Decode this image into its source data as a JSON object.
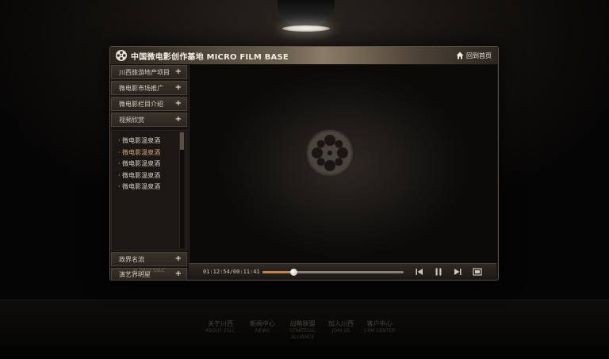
{
  "header": {
    "title": "中国微电影创作基地 MICRO FILM BASE",
    "home_label": "回到首页"
  },
  "sidebar": {
    "items": [
      {
        "label": "川西旅游地产项目",
        "toggle": "+"
      },
      {
        "label": "微电影市场推广",
        "toggle": "+"
      },
      {
        "label": "微电影栏目介绍",
        "toggle": "+"
      },
      {
        "label": "视频欣赏",
        "toggle": "+"
      }
    ],
    "sub_items": [
      {
        "label": "· 微电影温泉酒"
      },
      {
        "label": "· 微电影温泉酒"
      },
      {
        "label": "· 微电影温泉酒"
      },
      {
        "label": "· 微电影温泉酒"
      },
      {
        "label": "· 微电影温泉酒"
      }
    ],
    "active_sub_index": 1,
    "bottom_items": [
      {
        "label": "政界名流",
        "toggle": "+"
      },
      {
        "label": "演艺界明星",
        "toggle": "+"
      }
    ],
    "copyright": "© 2012 SSLC"
  },
  "player": {
    "time": "01:12:54/00:11:41",
    "progress": 0.22
  },
  "footer": {
    "links": [
      {
        "cn": "关于川西",
        "en": "ABOUT SSLC"
      },
      {
        "cn": "新闻中心",
        "en": "NEWS"
      },
      {
        "cn": "战略联盟",
        "en": "STRATEGIC",
        "en2": "ALLIANCE"
      },
      {
        "cn": "加入川西",
        "en": "JOIN US"
      },
      {
        "cn": "客户中心",
        "en": "CRM CENTER"
      }
    ]
  },
  "colors": {
    "accent": "#c4834c",
    "active_text": "#d7a978"
  }
}
